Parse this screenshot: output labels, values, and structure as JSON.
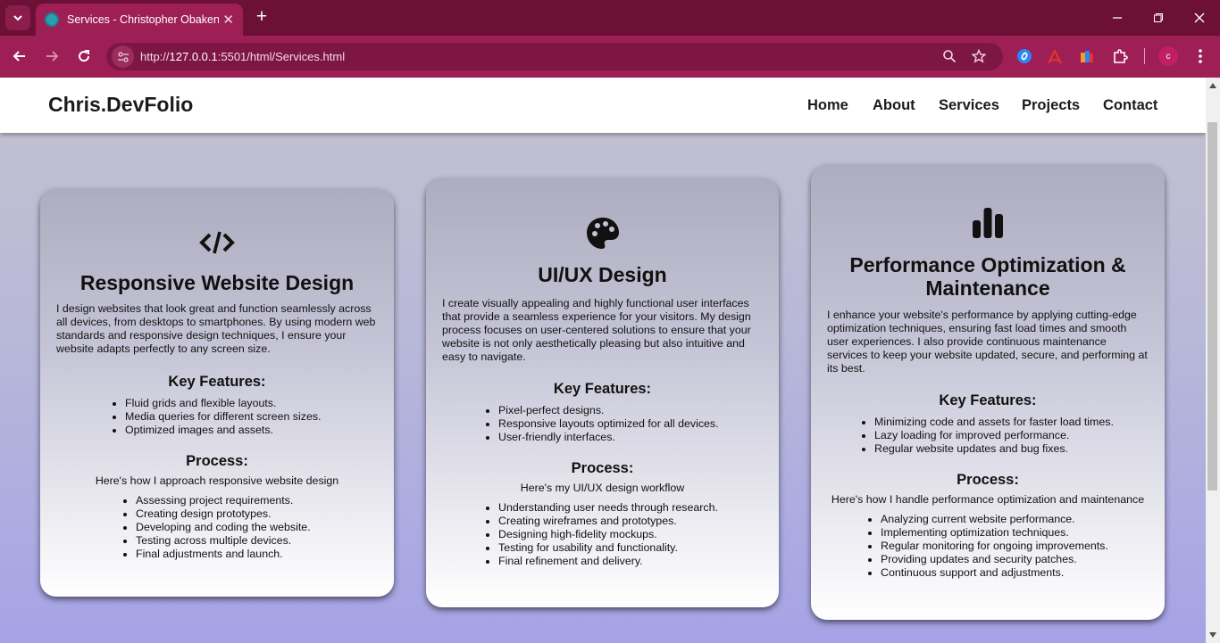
{
  "browser": {
    "tab_title": "Services - Christopher Obakeng",
    "url_prefix": "http://",
    "url_host": "127.0.0.1",
    "url_path": ":5501/html/Services.html",
    "profile_initial": "c"
  },
  "site": {
    "brand": "Chris.DevFolio",
    "nav": [
      "Home",
      "About",
      "Services",
      "Projects",
      "Contact"
    ]
  },
  "cards": [
    {
      "icon": "code-icon",
      "title": "Responsive Website Design",
      "description": "I design websites that look great and function seamlessly across all devices, from desktops to smartphones. By using modern web standards and responsive design techniques, I ensure your website adapts perfectly to any screen size.",
      "features_heading": "Key Features:",
      "features": [
        "Fluid grids and flexible layouts.",
        "Media queries for different screen sizes.",
        "Optimized images and assets."
      ],
      "process_heading": "Process:",
      "process_intro": "Here's how I approach responsive website design",
      "process": [
        "Assessing project requirements.",
        "Creating design prototypes.",
        "Developing and coding the website.",
        "Testing across multiple devices.",
        "Final adjustments and launch."
      ]
    },
    {
      "icon": "palette-icon",
      "title": "UI/UX Design",
      "description": "I create visually appealing and highly functional user interfaces that provide a seamless experience for your visitors. My design process focuses on user-centered solutions to ensure that your website is not only aesthetically pleasing but also intuitive and easy to navigate.",
      "features_heading": "Key Features:",
      "features": [
        "Pixel-perfect designs.",
        "Responsive layouts optimized for all devices.",
        "User-friendly interfaces."
      ],
      "process_heading": "Process:",
      "process_intro": "Here's my UI/UX design workflow",
      "process": [
        "Understanding user needs through research.",
        "Creating wireframes and prototypes.",
        "Designing high-fidelity mockups.",
        "Testing for usability and functionality.",
        "Final refinement and delivery."
      ]
    },
    {
      "icon": "bar-chart-icon",
      "title": "Performance Optimization & Maintenance",
      "description": "I enhance your website's performance by applying cutting-edge optimization techniques, ensuring fast load times and smooth user experiences. I also provide continuous maintenance services to keep your website updated, secure, and performing at its best.",
      "features_heading": "Key Features:",
      "features": [
        "Minimizing code and assets for faster load times.",
        "Lazy loading for improved performance.",
        "Regular website updates and bug fixes."
      ],
      "process_heading": "Process:",
      "process_intro": "Here's how I handle performance optimization and maintenance",
      "process": [
        "Analyzing current website performance.",
        "Implementing optimization techniques.",
        "Regular monitoring for ongoing improvements.",
        "Providing updates and security patches.",
        "Continuous support and adjustments."
      ]
    }
  ]
}
